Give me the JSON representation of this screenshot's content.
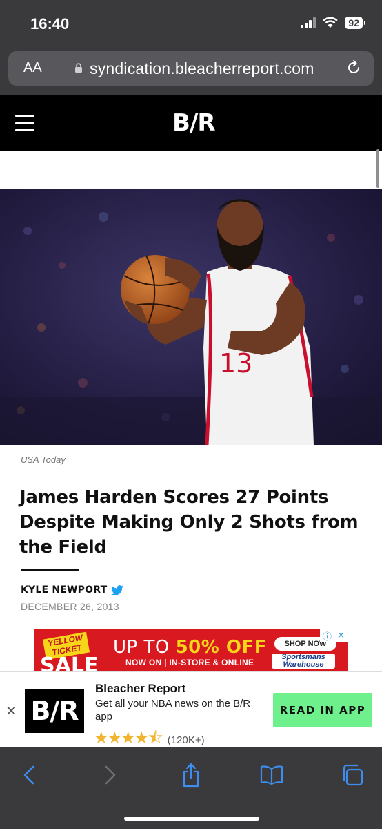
{
  "status_bar": {
    "time": "16:40",
    "battery": "92"
  },
  "browser": {
    "aa_label": "AA",
    "url": "syndication.bleacherreport.com"
  },
  "site": {
    "logo": "B/R"
  },
  "article": {
    "photo_credit": "USA Today",
    "headline": "James Harden Scores 27 Points Despite Making Only 2 Shots from the Field",
    "author": "KYLE NEWPORT",
    "date": "DECEMBER 26, 2013",
    "jersey_text": "13"
  },
  "ad": {
    "badge": "YELLOW TICKET",
    "sale": "SALE",
    "headline_prefix": "UP TO ",
    "headline_emphasis": "50% OFF",
    "subline": "NOW ON | IN-STORE & ONLINE",
    "shop_now": "SHOP NOW",
    "brand": "Sportsmans Warehouse"
  },
  "app_banner": {
    "icon_text": "B/R",
    "name": "Bleacher Report",
    "description": "Get all your NBA news on the B/R app",
    "rating_stars": 4.5,
    "stars_display": "★★★★⯪",
    "rating_count": "(120K+)",
    "cta": "READ IN APP"
  },
  "colors": {
    "accent_green": "#6ef08d",
    "ad_red": "#d8191f",
    "ios_blue": "#3d8ef0",
    "twitter_blue": "#1da1f2",
    "star_gold": "#f1b42f"
  }
}
